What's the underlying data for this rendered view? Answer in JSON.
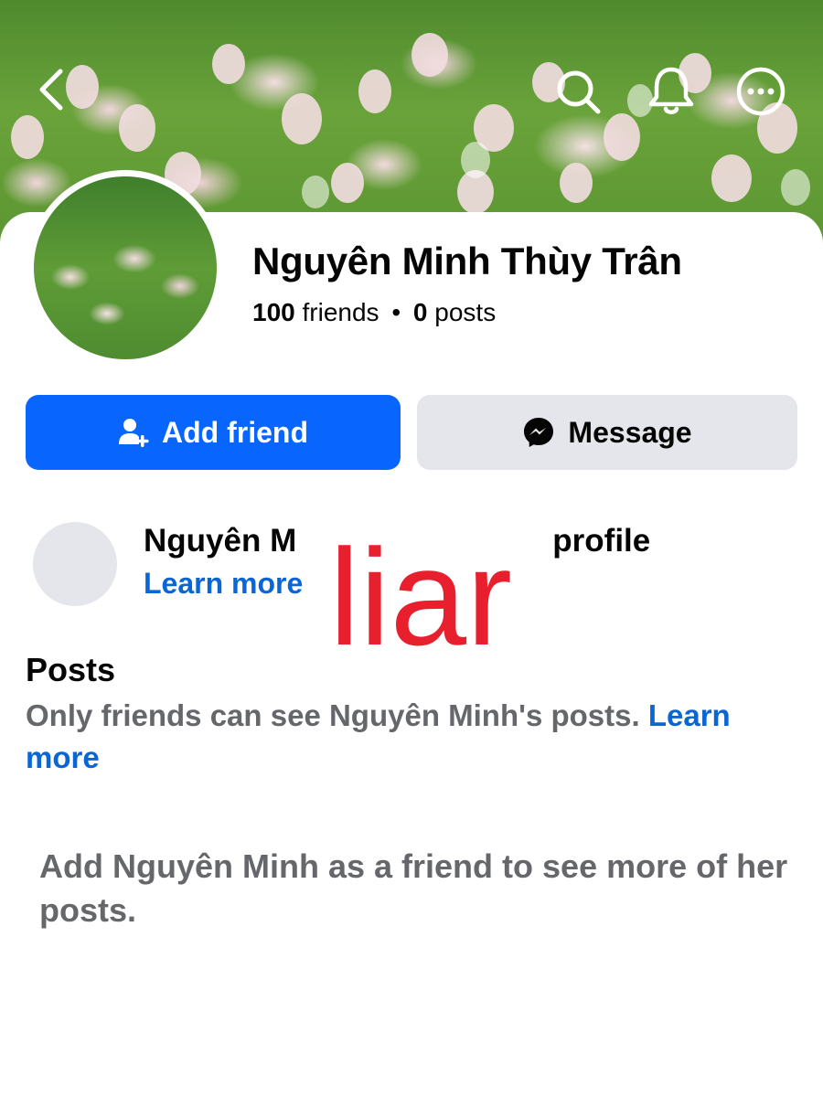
{
  "header": {
    "back_icon": "chevron-left-icon",
    "search_icon": "search-icon",
    "notifications_icon": "bell-icon",
    "more_icon": "more-horizontal-icon"
  },
  "profile": {
    "name": "Nguyên Minh Thùy Trân",
    "friends_count": "100",
    "friends_label": "friends",
    "separator": "•",
    "posts_count": "0",
    "posts_label": "posts"
  },
  "actions": {
    "add_friend_label": "Add friend",
    "add_friend_icon": "add-person-icon",
    "message_label": "Message",
    "message_icon": "messenger-icon"
  },
  "info_card": {
    "title_start": "Nguyên M",
    "title_end": "' profile",
    "link": "Learn more"
  },
  "overlay_text": "liar",
  "posts_section": {
    "heading": "Posts",
    "text": "Only friends can see Nguyên Minh's posts.",
    "link": "Learn more"
  },
  "add_note": "Add Nguyên Minh as a friend to see more of her posts.",
  "colors": {
    "primary": "#0866ff",
    "link": "#0a66d4",
    "secondary_button": "#e4e6eb",
    "overlay": "#e8202e",
    "muted_text": "#65676b"
  }
}
